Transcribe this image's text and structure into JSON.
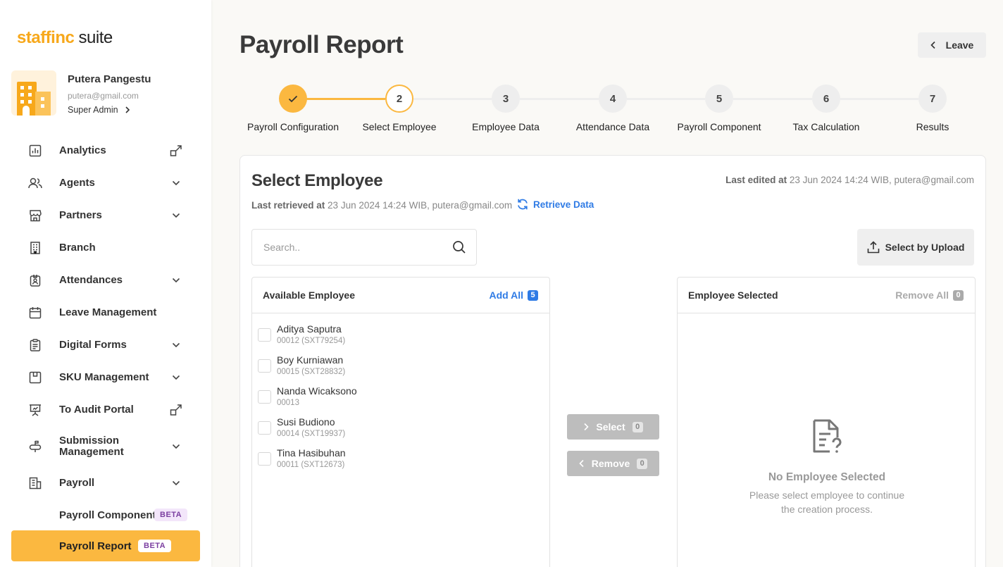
{
  "brand": {
    "part1": "staffinc",
    "part2": " suite",
    "accent": "#f7a81b"
  },
  "profile": {
    "name": "Putera Pangestu",
    "email": "putera@gmail.com",
    "role": "Super Admin"
  },
  "nav": {
    "analytics": "Analytics",
    "agents": "Agents",
    "partners": "Partners",
    "branch": "Branch",
    "attendances": "Attendances",
    "leave_management": "Leave Management",
    "digital_forms": "Digital Forms",
    "sku_management": "SKU Management",
    "to_audit_portal": "To Audit Portal",
    "submission_management_1": "Submission",
    "submission_management_2": "Management",
    "payroll": "Payroll",
    "payroll_component": "Payroll Component",
    "payroll_report": "Payroll Report",
    "beta": "BETA"
  },
  "header": {
    "title": "Payroll Report",
    "leave_label": "Leave"
  },
  "steps": [
    {
      "num": "1",
      "label": "Payroll Configuration",
      "state": "done"
    },
    {
      "num": "2",
      "label": "Select Employee",
      "state": "current"
    },
    {
      "num": "3",
      "label": "Employee Data",
      "state": "pending"
    },
    {
      "num": "4",
      "label": "Attendance Data",
      "state": "pending"
    },
    {
      "num": "5",
      "label": "Payroll Component",
      "state": "pending"
    },
    {
      "num": "6",
      "label": "Tax Calculation",
      "state": "pending"
    },
    {
      "num": "7",
      "label": "Results",
      "state": "pending"
    }
  ],
  "card": {
    "title": "Select Employee",
    "last_edited_label": "Last edited at",
    "last_edited_value": " 23 Jun 2024 14:24 WIB, putera@gmail.com",
    "last_retrieved_label": "Last retrieved at",
    "last_retrieved_value": " 23 Jun 2024 14:24 WIB, putera@gmail.com",
    "retrieve_label": "Retrieve Data",
    "search_placeholder": "Search..",
    "upload_label": "Select by Upload"
  },
  "available": {
    "title": "Available Employee",
    "add_all_label": "Add All",
    "count": "5",
    "employees": [
      {
        "name": "Aditya Saputra",
        "code": "00012 (SXT79254)"
      },
      {
        "name": "Boy Kurniawan",
        "code": "00015 (SXT28832)"
      },
      {
        "name": "Nanda Wicaksono",
        "code": "00013"
      },
      {
        "name": "Susi Budiono",
        "code": "00014 (SXT19937)"
      },
      {
        "name": "Tina Hasibuhan",
        "code": "00011 (SXT12673)"
      }
    ]
  },
  "actions": {
    "select_label": "Select",
    "select_count": "0",
    "remove_label": "Remove",
    "remove_count": "0"
  },
  "selected": {
    "title": "Employee Selected",
    "remove_all_label": "Remove All",
    "count": "0",
    "empty_title": "No Employee Selected",
    "empty_desc": "Please select employee to continue the creation process."
  }
}
